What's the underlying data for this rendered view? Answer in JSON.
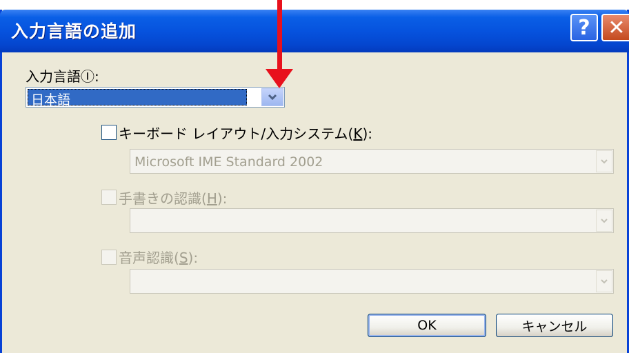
{
  "window": {
    "title": "入力言語の追加",
    "help_label": "?",
    "close_label": "✕"
  },
  "input_language": {
    "label": "入力言語",
    "mnemonic": "Ⓘ",
    "colon": ":",
    "selected": "日本語"
  },
  "keyboard": {
    "label": "キーボード レイアウト/入力システム(",
    "mnemonic": "K",
    "suffix": "):",
    "checked": false,
    "value": "Microsoft IME Standard 2002"
  },
  "handwriting": {
    "label": "手書きの認識(",
    "mnemonic": "H",
    "suffix": "):",
    "checked": false,
    "value": ""
  },
  "speech": {
    "label": "音声認識(",
    "mnemonic": "S",
    "suffix": "):",
    "checked": false,
    "value": ""
  },
  "buttons": {
    "ok": "OK",
    "cancel": "キャンセル"
  },
  "colors": {
    "titlebar": "#0653de",
    "selection": "#316ac5",
    "annotation_arrow": "#e8111c"
  }
}
